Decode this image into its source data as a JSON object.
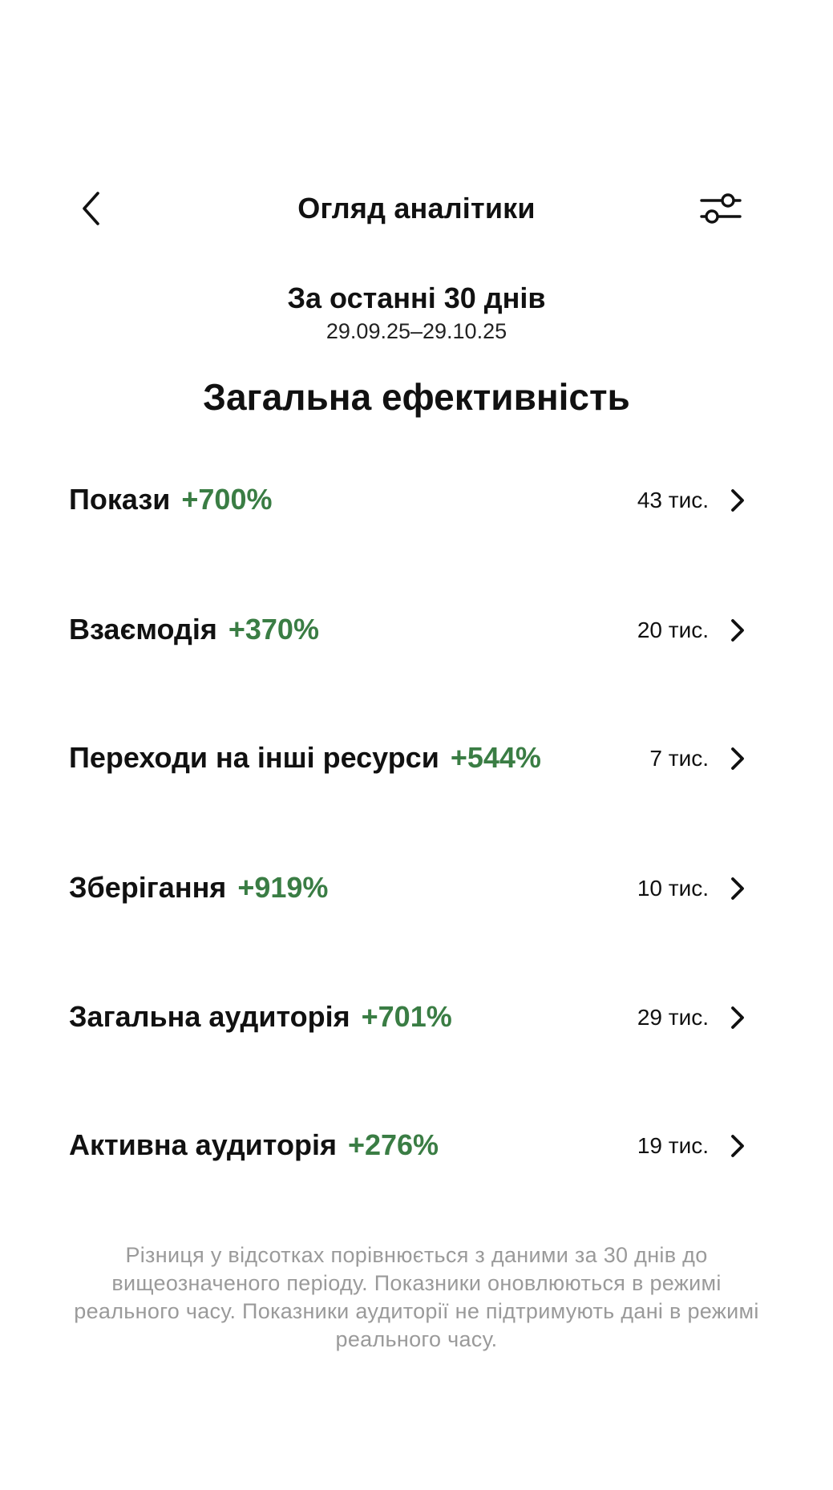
{
  "header": {
    "title": "Огляд аналітики",
    "back_icon": "chevron-left-icon",
    "filter_icon": "sliders-icon"
  },
  "period": {
    "title": "За останні 30 днів",
    "dates": "29.09.25–29.10.25"
  },
  "section_title": "Загальна ефективність",
  "metrics": [
    {
      "name": "Покази",
      "change": "+700%",
      "value": "43 тис."
    },
    {
      "name": "Взаємодія",
      "change": "+370%",
      "value": "20 тис."
    },
    {
      "name": "Переходи на інші ресурси",
      "change": "+544%",
      "value": "7 тис."
    },
    {
      "name": "Зберігання",
      "change": "+919%",
      "value": "10 тис."
    },
    {
      "name": "Загальна аудиторія",
      "change": "+701%",
      "value": "29 тис."
    },
    {
      "name": "Активна аудиторія",
      "change": "+276%",
      "value": "19 тис."
    }
  ],
  "footnote": "Різниця у відсотках порівнюється з даними за 30 днів до вищеозначеного періоду. Показники оновлюються в режимі реального часу. Показники аудиторії не підтримують дані в режимі реального часу.",
  "colors": {
    "positive_change": "#3a7d44",
    "footnote_text": "#9a9a9a",
    "text": "#111111",
    "background": "#ffffff"
  }
}
